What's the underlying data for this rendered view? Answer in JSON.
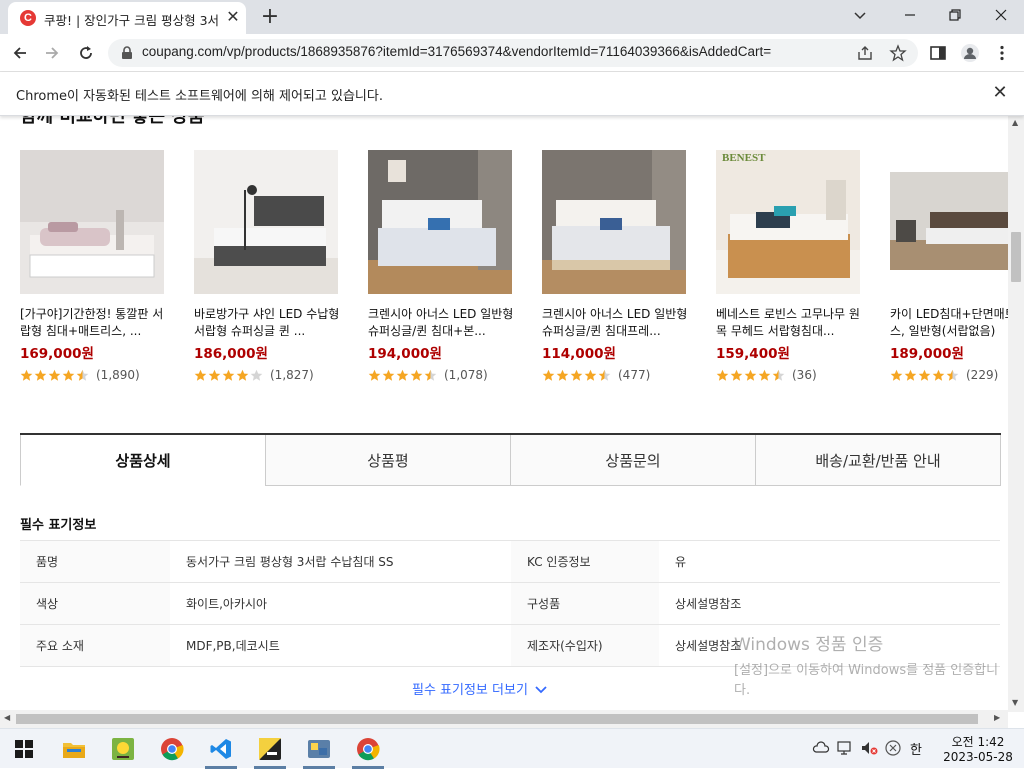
{
  "browser": {
    "tab_title": "쿠팡! | 장인가구 크림 평상형 3서",
    "tab_favicon": "C",
    "url": "coupang.com/vp/products/1868935876?itemId=3176569374&vendorItemId=71164039366&isAddedCart=",
    "infobar_text": "Chrome이 자동화된 테스트 소프트웨어에 의해 제어되고 있습니다."
  },
  "page": {
    "section_heading": "함께 비교하면 좋은 상품",
    "products": [
      {
        "name": "[가구야]기간한정! 통깔판 서랍형 침대+매트리스, ...",
        "price": "169,000원",
        "rating": 4.5,
        "reviews": "(1,890)"
      },
      {
        "name": "바로방가구 샤인 LED 수납형 서랍형 슈퍼싱글 퀸 ...",
        "price": "186,000원",
        "rating": 4.0,
        "reviews": "(1,827)"
      },
      {
        "name": "크렌시아 아너스 LED 일반형 슈퍼싱글/퀸 침대+본...",
        "price": "194,000원",
        "rating": 4.5,
        "reviews": "(1,078)"
      },
      {
        "name": "크렌시아 아너스 LED 일반형 슈퍼싱글/퀸 침대프레...",
        "price": "114,000원",
        "rating": 4.5,
        "reviews": "(477)"
      },
      {
        "name": "베네스트 로빈스 고무나무 원목 무헤드 서랍형침대...",
        "price": "159,400원",
        "rating": 4.5,
        "reviews": "(36)"
      },
      {
        "name": "카이 LED침대+단면매트리스, 일반형(서랍없음)",
        "price": "189,000원",
        "rating": 4.5,
        "reviews": "(229)"
      }
    ],
    "brand_label": "BENEST",
    "detail_tabs": [
      "상품상세",
      "상품평",
      "상품문의",
      "배송/교환/반품 안내"
    ],
    "notice_heading": "필수 표기정보",
    "spec_rows": [
      {
        "k1": "품명",
        "v1": "동서가구 크림 평상형 3서랍 수납침대 SS",
        "k2": "KC 인증정보",
        "v2": "유"
      },
      {
        "k1": "색상",
        "v1": "화이트,아카시아",
        "k2": "구성품",
        "v2": "상세설명참조"
      },
      {
        "k1": "주요 소재",
        "v1": "MDF,PB,데코시트",
        "k2": "제조자(수입자)",
        "v2": "상세설명참조"
      }
    ],
    "more_link": "필수 표기정보 더보기"
  },
  "watermark": {
    "title": "Windows 정품 인증",
    "subtitle": "[설정]으로 이동하여 Windows를 정품 인증합니다."
  },
  "taskbar": {
    "time": "오전 1:42",
    "date": "2023-05-28",
    "ime": "한"
  },
  "colors": {
    "price": "#ae0000",
    "star": "#f5a623",
    "star_empty": "#d5d5d5",
    "link": "#346aff"
  },
  "icons": [
    "chrome-icon",
    "vscode-icon",
    "folder-icon",
    "back-arrow-icon",
    "star-icon"
  ]
}
